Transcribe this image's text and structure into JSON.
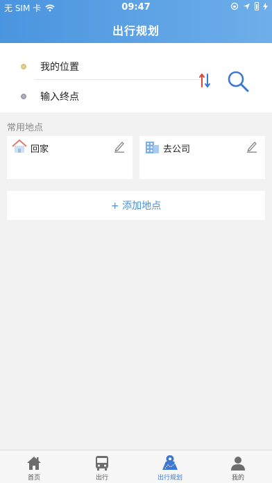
{
  "status_bar": {
    "carrier": "无 SIM 卡",
    "time": "09:47"
  },
  "header": {
    "title": "出行规划"
  },
  "route": {
    "from_label": "我的位置",
    "to_placeholder": "输入终点"
  },
  "common_places": {
    "section_title": "常用地点",
    "places": [
      {
        "name": "回家",
        "icon": "house-icon"
      },
      {
        "name": "去公司",
        "icon": "office-building-icon"
      }
    ],
    "add_label": "+ 添加地点"
  },
  "tabbar": {
    "tabs": [
      {
        "label": "首页",
        "icon": "home-icon",
        "active": false
      },
      {
        "label": "出行",
        "icon": "bus-icon",
        "active": false
      },
      {
        "label": "出行规划",
        "icon": "map-route-icon",
        "active": true
      },
      {
        "label": "我的",
        "icon": "person-icon",
        "active": false
      }
    ]
  },
  "colors": {
    "header_start": "#4a95df",
    "header_end": "#6eaeea",
    "accent": "#3b78d4",
    "background": "#f2f2f2"
  }
}
